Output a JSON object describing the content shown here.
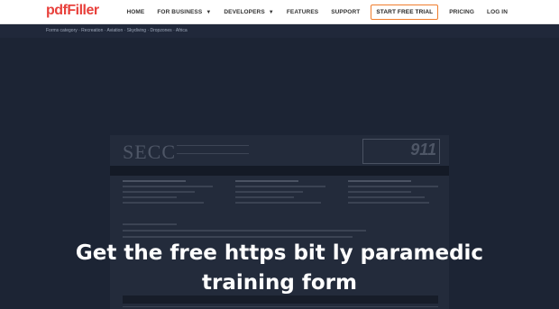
{
  "header": {
    "logo": "pdfFiller",
    "nav": {
      "home": "HOME",
      "for_business": "FOR BUSINESS",
      "developers": "DEVELOPERS",
      "features": "FEATURES",
      "support": "SUPPORT",
      "start_free_trial": "START FREE TRIAL",
      "pricing": "PRICING",
      "log_in": "LOG IN"
    }
  },
  "breadcrumb": "Forms category · Recreation · Aviation · Skydiving · Dropzones · Africa",
  "preview": {
    "doc_logo": "SECC",
    "doc_badge": "911"
  },
  "overlay": {
    "line1": "Get the free https bit ly paramedic",
    "line2": "training form"
  },
  "colors": {
    "brand": "#e8413c",
    "cta_border": "#f07d2d",
    "page_bg": "#1b2230"
  }
}
